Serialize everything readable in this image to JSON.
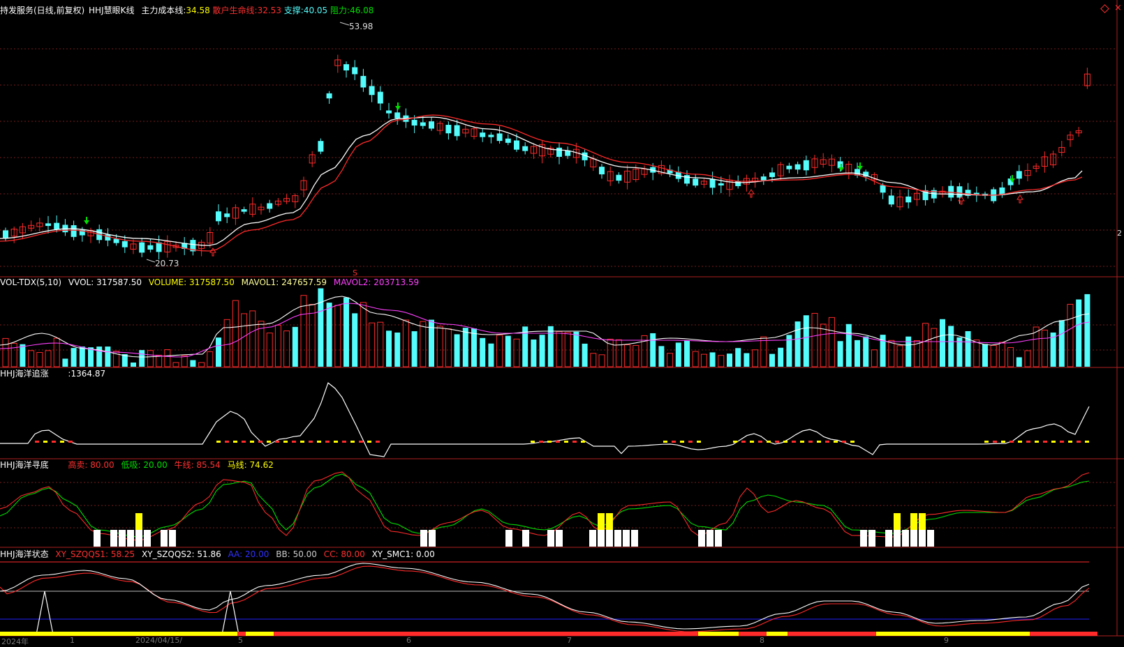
{
  "colors": {
    "bg": "#000000",
    "up": "#ff2a2a",
    "down": "#54fcfc",
    "white": "#ffffff",
    "yellow": "#ffff00",
    "green": "#00e000",
    "magenta": "#ff40ff",
    "blue": "#2020ff",
    "grid": "#7a1c1c",
    "frame": "#b02020"
  },
  "main": {
    "title": "持发服务(日线,前复权)",
    "indicator": "HHJ慧眼K线",
    "cost_label": "主力成本线:",
    "cost_value": "34.58",
    "retail_label": "散户生命线:",
    "retail_value": "32.53",
    "support_label": "支撑:",
    "support_value": "40.05",
    "resist_label": "阻力:",
    "resist_value": "46.08",
    "high_label": "53.98",
    "low_label": "20.73",
    "s_marker": "S",
    "right_edge_label": "2",
    "corner_icon": "diamond-icon"
  },
  "volume": {
    "name": "VOL-TDX(5,10)",
    "vvol_label": "VVOL:",
    "vvol_value": "317587.50",
    "volume_label": "VOLUME:",
    "volume_value": "317587.50",
    "mavol1_label": "MAVOL1:",
    "mavol1_value": "247657.59",
    "mavol2_label": "MAVOL2:",
    "mavol2_value": "203713.59"
  },
  "chase": {
    "name": "HHJ海洋追涨",
    "value_label": ":",
    "value": "1364.87"
  },
  "bottom": {
    "name": "HHJ海洋寻底",
    "sell_label": "高卖:",
    "sell_value": "80.00",
    "buy_label": "低吸:",
    "buy_value": "20.00",
    "ox_label": "牛线:",
    "ox_value": "85.54",
    "horse_label": "马线:",
    "horse_value": "74.62"
  },
  "state": {
    "name": "HHJ海洋状态",
    "s1_label": "XY_SZQQS1:",
    "s1_value": "58.25",
    "s2_label": "XY_SZQQS2:",
    "s2_value": "51.86",
    "aa_label": "AA:",
    "aa_value": "20.00",
    "bb_label": "BB:",
    "bb_value": "50.00",
    "cc_label": "CC:",
    "cc_value": "80.00",
    "smc_label": "XY_SMC1:",
    "smc_value": "0.00"
  },
  "time_axis": [
    "2024年",
    "1",
    "2024/04/15/",
    "5",
    "6",
    "7",
    "8",
    "9"
  ]
}
